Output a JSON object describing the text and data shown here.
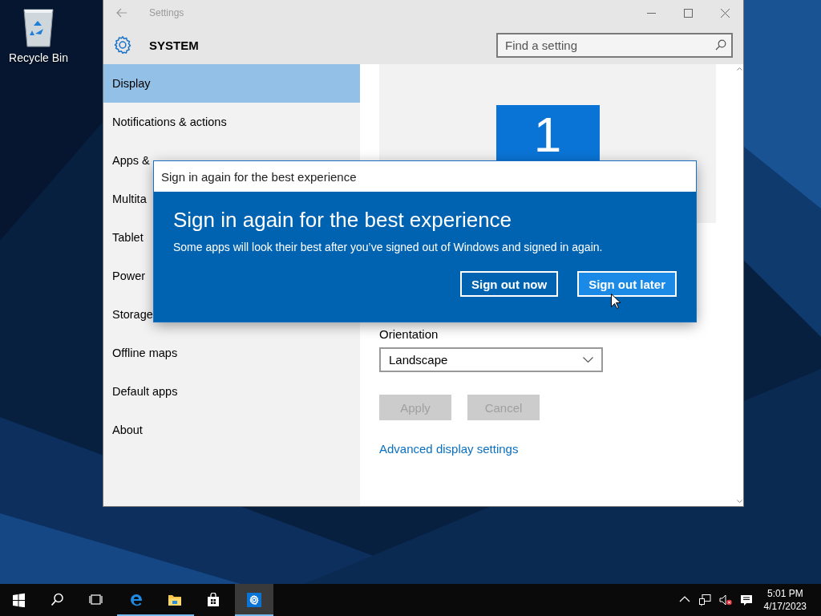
{
  "desktop_icons": [
    {
      "label": "Recycle Bin"
    }
  ],
  "window": {
    "title": "Settings",
    "section": "SYSTEM",
    "search": {
      "placeholder": "Find a setting"
    }
  },
  "sidebar": {
    "items": [
      {
        "label": "Display",
        "selected": true
      },
      {
        "label": "Notifications & actions",
        "selected": false
      },
      {
        "label": "Apps &",
        "selected": false
      },
      {
        "label": "Multita",
        "selected": false
      },
      {
        "label": "Tablet",
        "selected": false
      },
      {
        "label": "Power",
        "selected": false
      },
      {
        "label": "Storage",
        "selected": false
      },
      {
        "label": "Offline maps",
        "selected": false
      },
      {
        "label": "Default apps",
        "selected": false
      },
      {
        "label": "About",
        "selected": false
      }
    ]
  },
  "display": {
    "monitor_label": "1",
    "orientation": {
      "label": "Orientation",
      "value": "Landscape"
    },
    "buttons": [
      {
        "label": "Apply",
        "disabled": true
      },
      {
        "label": "Cancel",
        "disabled": true
      }
    ],
    "link": "Advanced display settings"
  },
  "dialog": {
    "title": "Sign in again for the best experience",
    "heading": "Sign in again for the best experience",
    "message": "Some apps will look their best after you’ve signed out of Windows and signed in again.",
    "buttons": [
      {
        "label": "Sign out now",
        "highlighted": false
      },
      {
        "label": "Sign out later",
        "highlighted": true
      }
    ]
  },
  "taskbar": {
    "items": [
      {
        "kind": "start",
        "running": false,
        "selected": false
      },
      {
        "kind": "search",
        "running": false,
        "selected": false
      },
      {
        "kind": "task-view",
        "running": false,
        "selected": false
      },
      {
        "kind": "browser",
        "running": true,
        "selected": false
      },
      {
        "kind": "folder",
        "running": true,
        "selected": false
      },
      {
        "kind": "store",
        "running": false,
        "selected": false
      },
      {
        "kind": "settings",
        "running": true,
        "selected": true
      }
    ],
    "tray": [
      {
        "kind": "chevron"
      },
      {
        "kind": "network"
      },
      {
        "kind": "volume-muted"
      },
      {
        "kind": "notifications"
      }
    ],
    "clock": {
      "time": "5:01 PM",
      "date": "4/17/2023"
    }
  }
}
